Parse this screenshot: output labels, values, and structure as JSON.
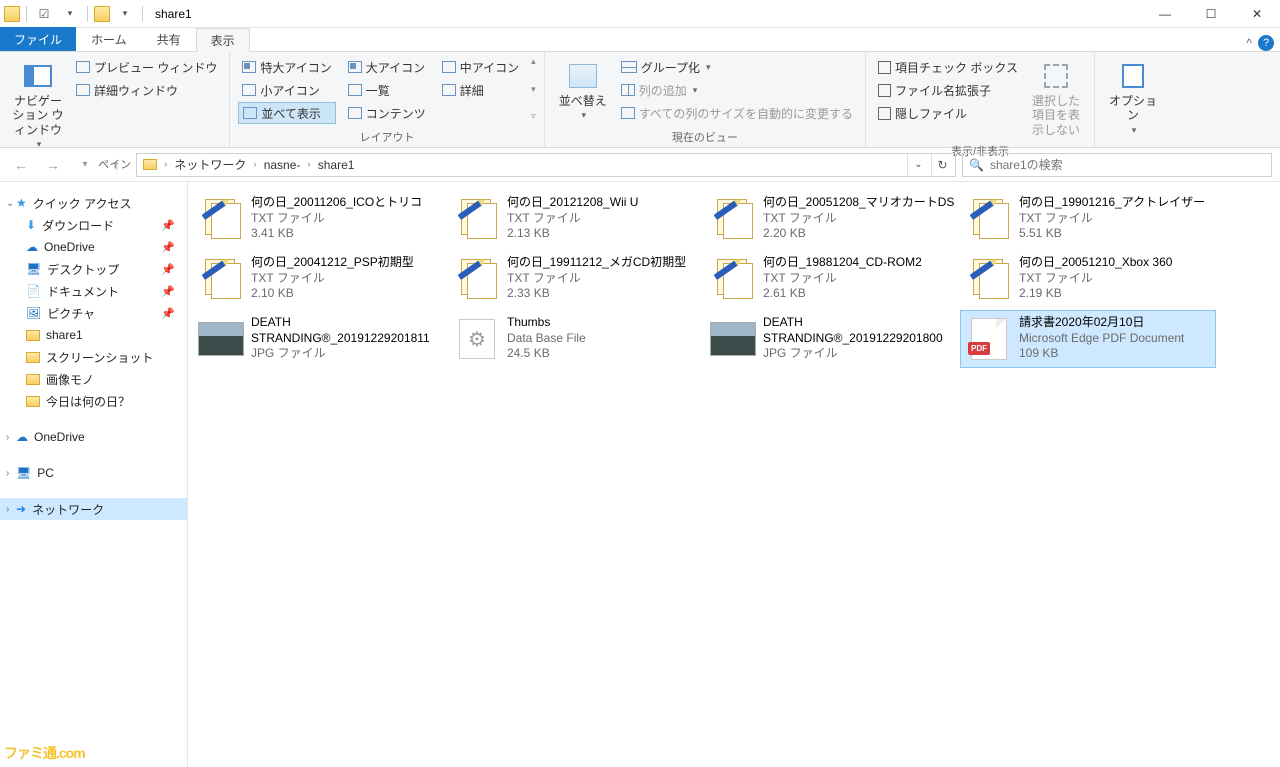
{
  "title": "share1",
  "tabs": {
    "file": "ファイル",
    "home": "ホーム",
    "share": "共有",
    "view": "表示"
  },
  "ribbon": {
    "panes": {
      "nav": "ナビゲーション ウィンドウ",
      "preview": "プレビュー ウィンドウ",
      "details": "詳細ウィンドウ",
      "label": "ペイン"
    },
    "layout": {
      "extra_large": "特大アイコン",
      "large": "大アイコン",
      "medium": "中アイコン",
      "small": "小アイコン",
      "list": "一覧",
      "details": "詳細",
      "tiles": "並べて表示",
      "content": "コンテンツ",
      "label": "レイアウト"
    },
    "currentview": {
      "sort": "並べ替え",
      "group": "グループ化",
      "addcol": "列の追加",
      "autosize": "すべての列のサイズを自動的に変更する",
      "label": "現在のビュー"
    },
    "showhide": {
      "item_check": "項目チェック ボックス",
      "file_ext": "ファイル名拡張子",
      "hidden": "隠しファイル",
      "hide_selected": "選択した項目を表示しない",
      "label": "表示/非表示"
    },
    "options": {
      "btn": "オプション"
    }
  },
  "breadcrumb": {
    "root": "ネットワーク",
    "host": "nasne-",
    "folder": "share1"
  },
  "search": {
    "placeholder": "share1の検索"
  },
  "sidebar": {
    "quick": "クイック アクセス",
    "downloads": "ダウンロード",
    "onedrive": "OneDrive",
    "desktop": "デスクトップ",
    "documents": "ドキュメント",
    "pictures": "ピクチャ",
    "share1": "share1",
    "screenshots": "スクリーンショット",
    "gazou": "画像モノ",
    "whatday": "今日は何の日？",
    "onedrive2": "OneDrive",
    "pc": "PC",
    "network": "ネットワーク"
  },
  "files": [
    {
      "name": "何の日_20011206_ICOとトリコ",
      "type": "TXT ファイル",
      "size": "3.41 KB",
      "icon": "txt"
    },
    {
      "name": "何の日_20121208_Wii U",
      "type": "TXT ファイル",
      "size": "2.13 KB",
      "icon": "txt"
    },
    {
      "name": "何の日_20051208_マリオカートDS",
      "type": "TXT ファイル",
      "size": "2.20 KB",
      "icon": "txt"
    },
    {
      "name": "何の日_19901216_アクトレイザー",
      "type": "TXT ファイル",
      "size": "5.51 KB",
      "icon": "txt"
    },
    {
      "name": "何の日_20041212_PSP初期型",
      "type": "TXT ファイル",
      "size": "2.10 KB",
      "icon": "txt"
    },
    {
      "name": "何の日_19911212_メガCD初期型",
      "type": "TXT ファイル",
      "size": "2.33 KB",
      "icon": "txt"
    },
    {
      "name": "何の日_19881204_CD-ROM2",
      "type": "TXT ファイル",
      "size": "2.61 KB",
      "icon": "txt"
    },
    {
      "name": "何の日_20051210_Xbox 360",
      "type": "TXT ファイル",
      "size": "2.19 KB",
      "icon": "txt"
    },
    {
      "name": "DEATH STRANDING®_20191229201811",
      "type": "JPG ファイル",
      "size": "",
      "icon": "jpg"
    },
    {
      "name": "Thumbs",
      "type": "Data Base File",
      "size": "24.5 KB",
      "icon": "db"
    },
    {
      "name": "DEATH STRANDING®_20191229201800",
      "type": "JPG ファイル",
      "size": "",
      "icon": "jpg"
    },
    {
      "name": "請求書2020年02月10日",
      "type": "Microsoft Edge PDF Document",
      "size": "109 KB",
      "icon": "pdf",
      "selected": true
    }
  ],
  "watermark": "ファミ通.com"
}
